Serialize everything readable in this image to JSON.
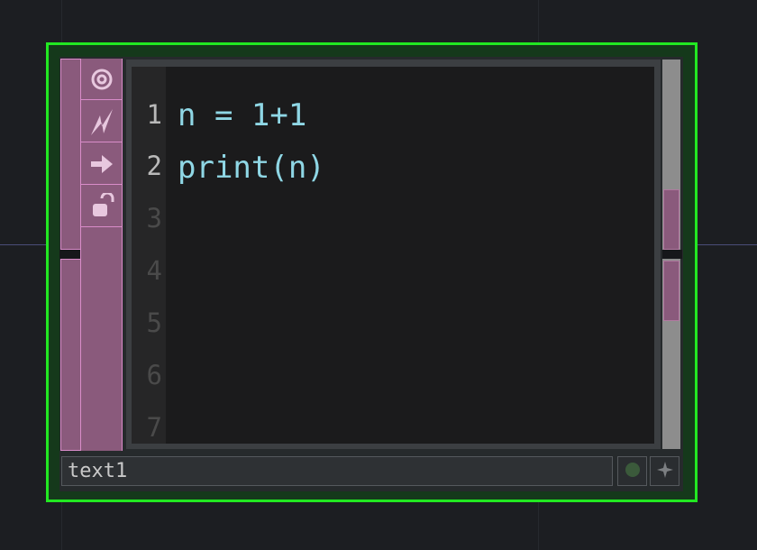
{
  "node": {
    "name": "text1",
    "outline_color": "#22e822",
    "panel_color": "#8a5a7c"
  },
  "toolbar": {
    "buttons": [
      {
        "icon": "viewer-toggle-icon"
      },
      {
        "icon": "cook-flag-icon"
      },
      {
        "icon": "arrow-right-icon"
      },
      {
        "icon": "unlock-icon"
      }
    ]
  },
  "editor": {
    "lines": [
      {
        "number": "1",
        "code": "n = 1+1"
      },
      {
        "number": "2",
        "code": "print(n)"
      },
      {
        "number": "3",
        "code": ""
      },
      {
        "number": "4",
        "code": ""
      },
      {
        "number": "5",
        "code": ""
      },
      {
        "number": "6",
        "code": ""
      },
      {
        "number": "7",
        "code": ""
      }
    ],
    "code_color": "#8fd7e5"
  },
  "bottom_bar": {
    "status_icon": "status-dot-icon",
    "add_icon": "plus-icon"
  }
}
